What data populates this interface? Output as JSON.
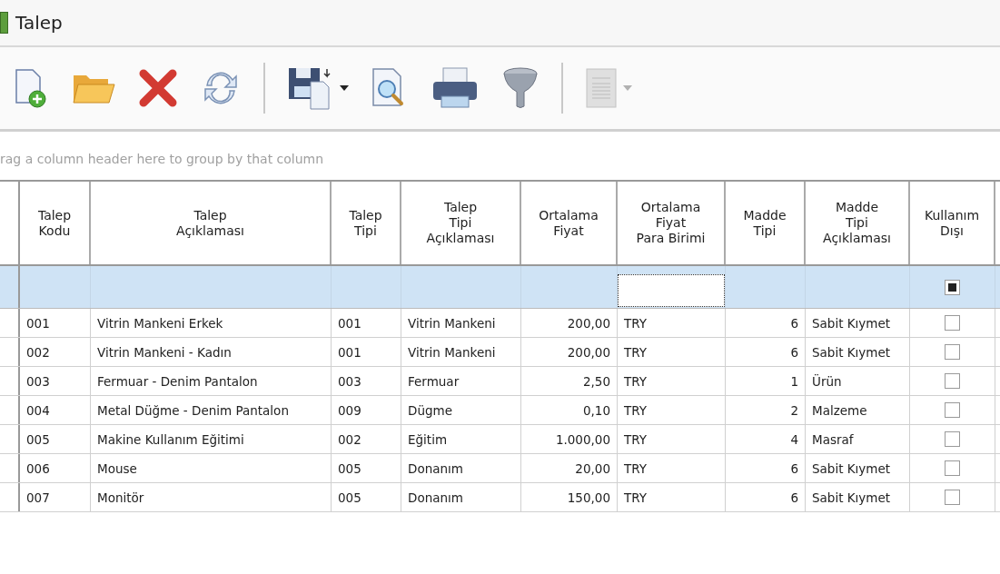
{
  "window": {
    "title": "Talep"
  },
  "toolbar": [
    {
      "kind": "new",
      "disabled": false,
      "dropdown": false
    },
    {
      "kind": "open",
      "disabled": false,
      "dropdown": false
    },
    {
      "kind": "delete",
      "disabled": false,
      "dropdown": false
    },
    {
      "kind": "refresh",
      "disabled": false,
      "dropdown": false
    },
    {
      "kind": "separator"
    },
    {
      "kind": "save",
      "disabled": false,
      "dropdown": true
    },
    {
      "kind": "preview",
      "disabled": false,
      "dropdown": false
    },
    {
      "kind": "print",
      "disabled": false,
      "dropdown": false
    },
    {
      "kind": "filter",
      "disabled": false,
      "dropdown": false
    },
    {
      "kind": "separator"
    },
    {
      "kind": "report",
      "disabled": true,
      "dropdown": true
    }
  ],
  "group_panel": {
    "hint": "rag a column header here to group by that column"
  },
  "table": {
    "columns": [
      {
        "label": "Talep\nKodu"
      },
      {
        "label": "Talep\nAçıklaması"
      },
      {
        "label": "Talep\nTipi"
      },
      {
        "label": "Talep\nTipi\nAçıklaması"
      },
      {
        "label": "Ortalama\nFiyat"
      },
      {
        "label": "Ortalama\nFiyat\nPara Birimi"
      },
      {
        "label": "Madde\nTipi"
      },
      {
        "label": "Madde\nTipi\nAçıklaması"
      },
      {
        "label": "Kullanım\nDışı"
      }
    ],
    "filter_row": [
      {
        "kind": "blank"
      },
      {
        "kind": "blank"
      },
      {
        "kind": "blank"
      },
      {
        "kind": "blank"
      },
      {
        "kind": "blank"
      },
      {
        "kind": "input",
        "focused": true
      },
      {
        "kind": "blank"
      },
      {
        "kind": "blank"
      },
      {
        "kind": "checkbox",
        "checked": true
      }
    ],
    "rows": [
      {
        "cells": [
          "001",
          "Vitrin Mankeni Erkek",
          "001",
          "Vitrin Mankeni",
          "200,00",
          "TRY",
          "6",
          "Sabit Kıymet"
        ],
        "kullanim_disi": false
      },
      {
        "cells": [
          "002",
          "Vitrin Mankeni - Kadın",
          "001",
          "Vitrin Mankeni",
          "200,00",
          "TRY",
          "6",
          "Sabit Kıymet"
        ],
        "kullanim_disi": false
      },
      {
        "cells": [
          "003",
          "Fermuar - Denim Pantalon",
          "003",
          "Fermuar",
          "2,50",
          "TRY",
          "1",
          "Ürün"
        ],
        "kullanim_disi": false
      },
      {
        "cells": [
          "004",
          "Metal Düğme - Denim Pantalon",
          "009",
          "Dügme",
          "0,10",
          "TRY",
          "2",
          "Malzeme"
        ],
        "kullanim_disi": false
      },
      {
        "cells": [
          "005",
          "Makine Kullanım Eğitimi",
          "002",
          "Eğitim",
          "1.000,00",
          "TRY",
          "4",
          "Masraf"
        ],
        "kullanim_disi": false
      },
      {
        "cells": [
          "006",
          "Mouse",
          "005",
          "Donanım",
          "20,00",
          "TRY",
          "6",
          "Sabit Kıymet"
        ],
        "kullanim_disi": false
      },
      {
        "cells": [
          "007",
          "Monitör",
          "005",
          "Donanım",
          "150,00",
          "TRY",
          "6",
          "Sabit Kıymet"
        ],
        "kullanim_disi": false
      }
    ]
  }
}
